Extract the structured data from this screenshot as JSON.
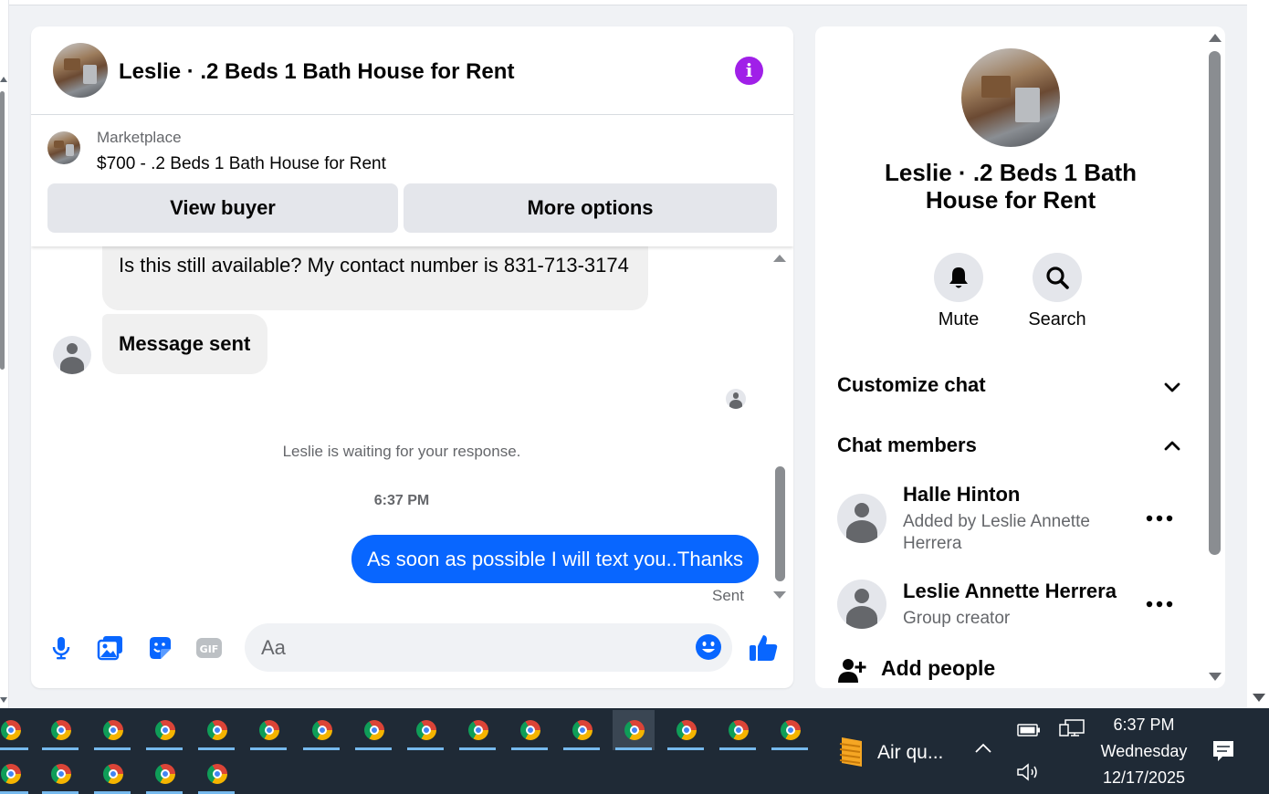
{
  "chat": {
    "title": "Leslie · .2 Beds 1 Bath House for Rent",
    "info_icon": "info-icon",
    "marketplace_label": "Marketplace",
    "listing": "$700 - .2 Beds 1 Bath House for Rent",
    "view_buyer_label": "View buyer",
    "more_options_label": "More options",
    "messages": [
      {
        "direction": "incoming",
        "text": "Is this still available? My contact number is 831-713-3174"
      },
      {
        "direction": "incoming",
        "text": "Message sent"
      }
    ],
    "waiting_notice": "Leslie is waiting for your response.",
    "time_separator": "6:37 PM",
    "outgoing_message": "As soon as possible I will text you..Thanks",
    "sent_status": "Sent",
    "composer": {
      "placeholder": "Aa",
      "icons": [
        "microphone-icon",
        "photo-icon",
        "sticker-icon",
        "gif-icon",
        "emoji-icon",
        "thumbs-up-icon"
      ]
    },
    "accent_color": "#0866ff"
  },
  "details": {
    "title": "Leslie · .2 Beds 1 Bath House for Rent",
    "mute_label": "Mute",
    "search_label": "Search",
    "customize_chat_label": "Customize chat",
    "chat_members_label": "Chat members",
    "members": [
      {
        "name": "Halle Hinton",
        "subtitle": "Added by Leslie Annette Herrera"
      },
      {
        "name": "Leslie Annette Herrera",
        "subtitle": "Group creator"
      }
    ],
    "add_people_label": "Add people"
  },
  "taskbar": {
    "weather_text": "Air qu...",
    "clock_time": "6:37 PM",
    "clock_day": "Wednesday",
    "clock_date": "12/17/2025",
    "app_icons": "chrome-icon",
    "tray_icons": [
      "battery-icon",
      "network-icon",
      "volume-icon",
      "notification-icon"
    ]
  }
}
